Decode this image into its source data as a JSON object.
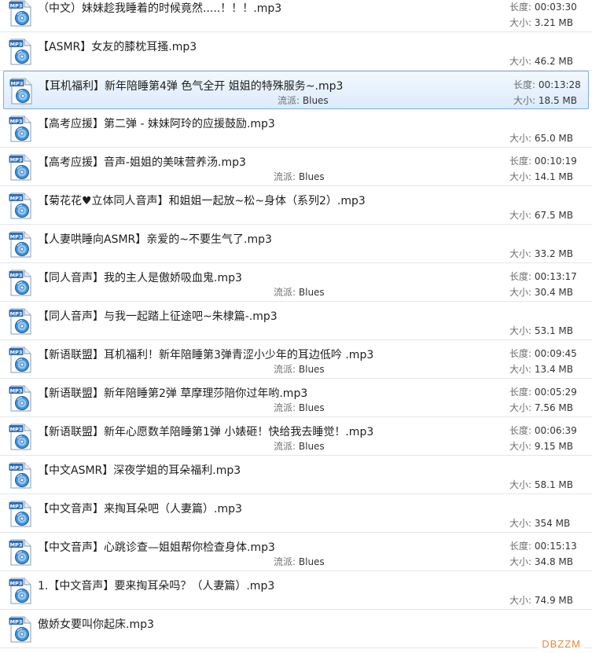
{
  "labels": {
    "length": "长度:",
    "size": "大小:",
    "genre": "流派:"
  },
  "icon_badge": "MP3",
  "watermark": "DBZZM",
  "items": [
    {
      "title": "（中文）妹妹趁我睡着的时候竟然.....！！！.mp3",
      "length": "00:03:30",
      "size": "3.21 MB",
      "genre": ""
    },
    {
      "title": "【ASMR】女友的膝枕耳搔.mp3",
      "length": "",
      "size": "46.2 MB",
      "genre": ""
    },
    {
      "title": "【耳机福利】新年陪睡第4弹 色气全开 姐姐的特殊服务~.mp3",
      "length": "00:13:28",
      "size": "18.5 MB",
      "genre": "Blues",
      "selected": true
    },
    {
      "title": "【高考应援】第二弹 - 妹妹阿玲的应援鼓励.mp3",
      "length": "",
      "size": "65.0 MB",
      "genre": ""
    },
    {
      "title": "【高考应援】音声-姐姐的美味营养汤.mp3",
      "length": "00:10:19",
      "size": "14.1 MB",
      "genre": "Blues"
    },
    {
      "title": "【菊花花♥立体同人音声】和姐姐一起放~松~身体（系列2）.mp3",
      "length": "",
      "size": "67.5 MB",
      "genre": ""
    },
    {
      "title": "【人妻哄睡向ASMR】亲爱的~不要生气了.mp3",
      "length": "",
      "size": "33.2 MB",
      "genre": ""
    },
    {
      "title": "【同人音声】我的主人是傲娇吸血鬼.mp3",
      "length": "00:13:17",
      "size": "30.4 MB",
      "genre": "Blues"
    },
    {
      "title": "【同人音声】与我一起踏上征途吧~朱棣篇-.mp3",
      "length": "",
      "size": "53.1 MB",
      "genre": ""
    },
    {
      "title": "【新语联盟】耳机福利！新年陪睡第3弹青涩小少年的耳边低吟 .mp3",
      "length": "00:09:45",
      "size": "13.4 MB",
      "genre": "Blues"
    },
    {
      "title": "【新语联盟】新年陪睡第2弹 草摩理莎陪你过年哟.mp3",
      "length": "00:05:29",
      "size": "7.56 MB",
      "genre": "Blues"
    },
    {
      "title": "【新语联盟】新年心愿数羊陪睡第1弹 小婊砸！快给我去睡觉！.mp3",
      "length": "00:06:39",
      "size": "9.15 MB",
      "genre": "Blues"
    },
    {
      "title": "【中文ASMR】深夜学姐的耳朵福利.mp3",
      "length": "",
      "size": "58.1 MB",
      "genre": ""
    },
    {
      "title": "【中文音声】来掏耳朵吧（人妻篇）.mp3",
      "length": "",
      "size": "354 MB",
      "genre": ""
    },
    {
      "title": "【中文音声】心跳诊查—姐姐帮你检查身体.mp3",
      "length": "00:15:13",
      "size": "34.8 MB",
      "genre": "Blues"
    },
    {
      "title": "1.【中文音声】要来掏耳朵吗？（人妻篇）.mp3",
      "length": "",
      "size": "74.9 MB",
      "genre": ""
    },
    {
      "title": "傲娇女要叫你起床.mp3",
      "length": "",
      "size": "",
      "genre": ""
    }
  ]
}
